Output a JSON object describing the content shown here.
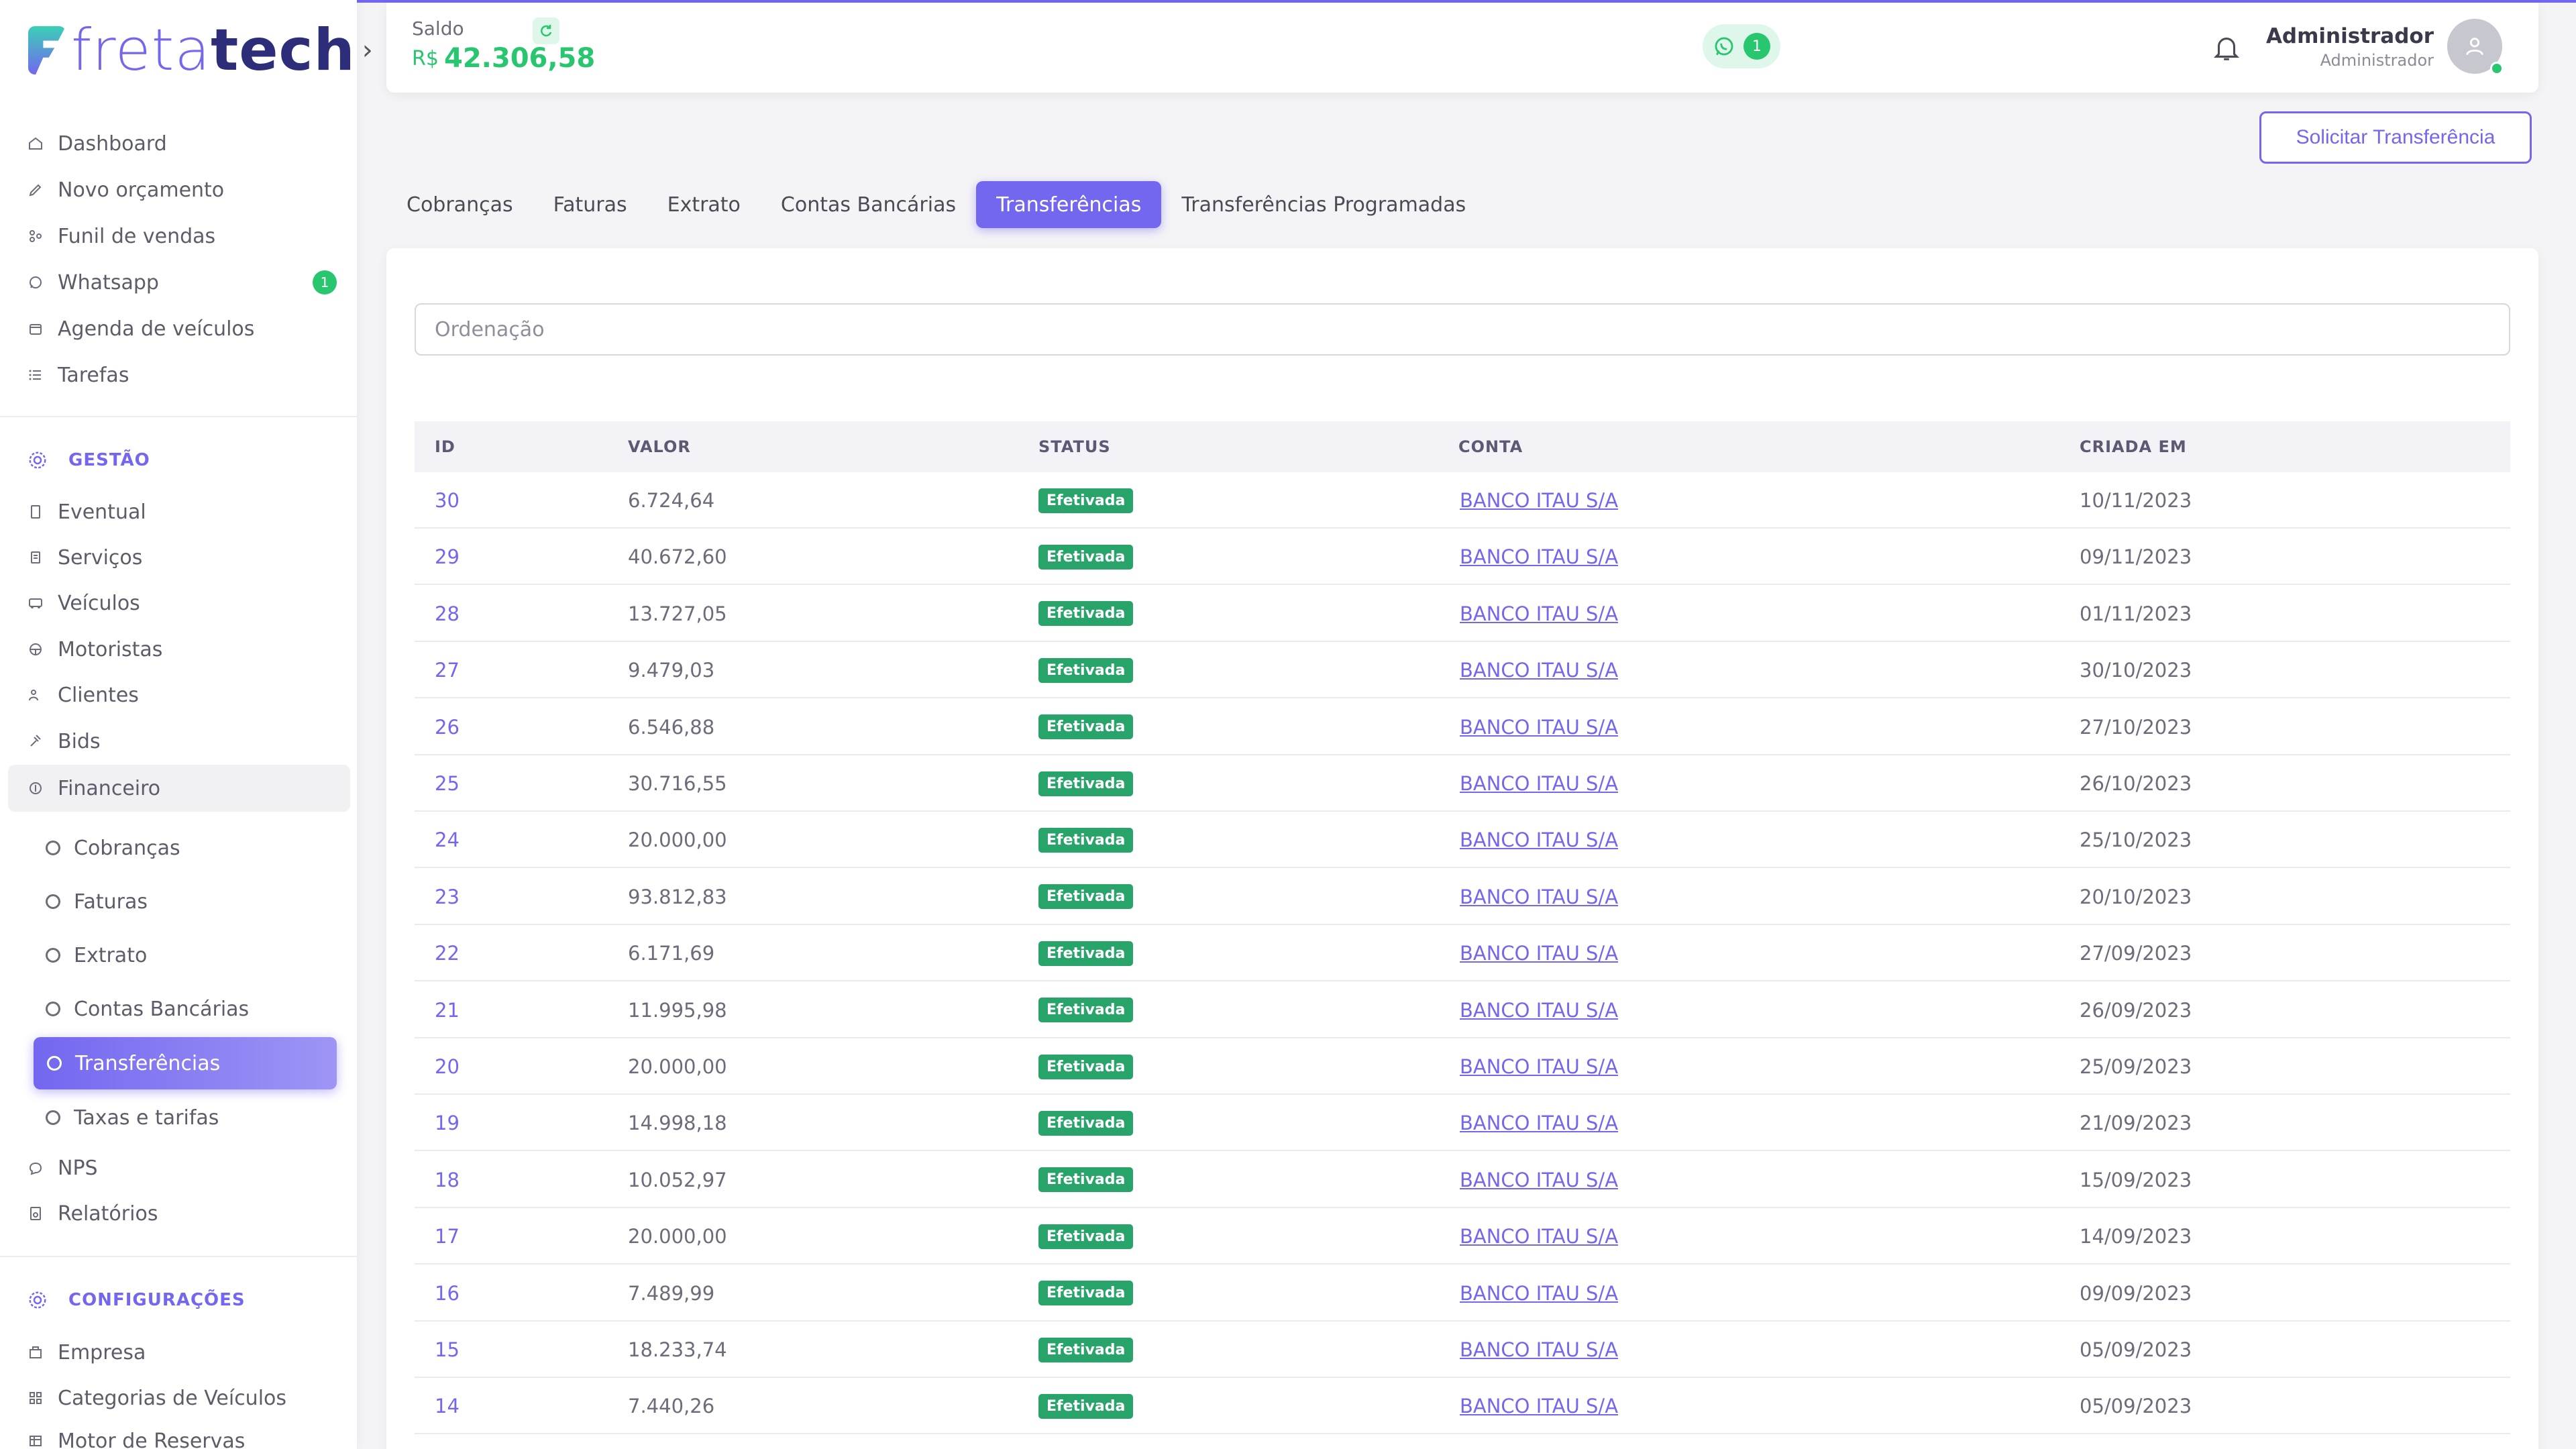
{
  "brand": {
    "name_light": "freta",
    "name_bold": "tech"
  },
  "sidebar": {
    "main_items": [
      {
        "label": "Dashboard"
      },
      {
        "label": "Novo orçamento"
      },
      {
        "label": "Funil de vendas"
      },
      {
        "label": "Whatsapp",
        "badge": "1"
      },
      {
        "label": "Agenda de veículos"
      },
      {
        "label": "Tarefas"
      }
    ],
    "gestao_title": "GESTÃO",
    "gestao_items": [
      {
        "label": "Eventual"
      },
      {
        "label": "Serviços"
      },
      {
        "label": "Veículos"
      },
      {
        "label": "Motoristas"
      },
      {
        "label": "Clientes"
      },
      {
        "label": "Bids"
      },
      {
        "label": "Financeiro"
      }
    ],
    "financeiro_sub": [
      {
        "label": "Cobranças"
      },
      {
        "label": "Faturas"
      },
      {
        "label": "Extrato"
      },
      {
        "label": "Contas Bancárias"
      },
      {
        "label": "Transferências"
      },
      {
        "label": "Taxas e tarifas"
      }
    ],
    "after_items": [
      {
        "label": "NPS"
      },
      {
        "label": "Relatórios"
      }
    ],
    "config_title": "CONFIGURAÇÕES",
    "config_items": [
      {
        "label": "Empresa"
      },
      {
        "label": "Categorias de Veículos"
      },
      {
        "label": "Motor de Reservas"
      }
    ]
  },
  "header": {
    "saldo_label": "Saldo",
    "saldo_currency": "R$",
    "saldo_value": "42.306,58",
    "whatsapp_count": "1",
    "user_name": "Administrador",
    "user_role": "Administrador"
  },
  "actions": {
    "solicitar_label": "Solicitar Transferência"
  },
  "tabs": [
    {
      "label": "Cobranças"
    },
    {
      "label": "Faturas"
    },
    {
      "label": "Extrato"
    },
    {
      "label": "Contas Bancárias"
    },
    {
      "label": "Transferências",
      "active": true
    },
    {
      "label": "Transferências Programadas"
    }
  ],
  "filter": {
    "placeholder": "Ordenação"
  },
  "table": {
    "headers": {
      "id": "ID",
      "valor": "VALOR",
      "status": "STATUS",
      "conta": "CONTA",
      "criada": "CRIADA EM"
    },
    "rows": [
      {
        "id": "30",
        "valor": "6.724,64",
        "status": "Efetivada",
        "conta": "BANCO ITAU S/A",
        "criada": "10/11/2023"
      },
      {
        "id": "29",
        "valor": "40.672,60",
        "status": "Efetivada",
        "conta": "BANCO ITAU S/A",
        "criada": "09/11/2023"
      },
      {
        "id": "28",
        "valor": "13.727,05",
        "status": "Efetivada",
        "conta": "BANCO ITAU S/A",
        "criada": "01/11/2023"
      },
      {
        "id": "27",
        "valor": "9.479,03",
        "status": "Efetivada",
        "conta": "BANCO ITAU S/A",
        "criada": "30/10/2023"
      },
      {
        "id": "26",
        "valor": "6.546,88",
        "status": "Efetivada",
        "conta": "BANCO ITAU S/A",
        "criada": "27/10/2023"
      },
      {
        "id": "25",
        "valor": "30.716,55",
        "status": "Efetivada",
        "conta": "BANCO ITAU S/A",
        "criada": "26/10/2023"
      },
      {
        "id": "24",
        "valor": "20.000,00",
        "status": "Efetivada",
        "conta": "BANCO ITAU S/A",
        "criada": "25/10/2023"
      },
      {
        "id": "23",
        "valor": "93.812,83",
        "status": "Efetivada",
        "conta": "BANCO ITAU S/A",
        "criada": "20/10/2023"
      },
      {
        "id": "22",
        "valor": "6.171,69",
        "status": "Efetivada",
        "conta": "BANCO ITAU S/A",
        "criada": "27/09/2023"
      },
      {
        "id": "21",
        "valor": "11.995,98",
        "status": "Efetivada",
        "conta": "BANCO ITAU S/A",
        "criada": "26/09/2023"
      },
      {
        "id": "20",
        "valor": "20.000,00",
        "status": "Efetivada",
        "conta": "BANCO ITAU S/A",
        "criada": "25/09/2023"
      },
      {
        "id": "19",
        "valor": "14.998,18",
        "status": "Efetivada",
        "conta": "BANCO ITAU S/A",
        "criada": "21/09/2023"
      },
      {
        "id": "18",
        "valor": "10.052,97",
        "status": "Efetivada",
        "conta": "BANCO ITAU S/A",
        "criada": "15/09/2023"
      },
      {
        "id": "17",
        "valor": "20.000,00",
        "status": "Efetivada",
        "conta": "BANCO ITAU S/A",
        "criada": "14/09/2023"
      },
      {
        "id": "16",
        "valor": "7.489,99",
        "status": "Efetivada",
        "conta": "BANCO ITAU S/A",
        "criada": "09/09/2023"
      },
      {
        "id": "15",
        "valor": "18.233,74",
        "status": "Efetivada",
        "conta": "BANCO ITAU S/A",
        "criada": "05/09/2023"
      },
      {
        "id": "14",
        "valor": "7.440,26",
        "status": "Efetivada",
        "conta": "BANCO ITAU S/A",
        "criada": "05/09/2023"
      }
    ]
  },
  "colors": {
    "accent": "#7367f0",
    "success": "#28c76f",
    "status_bg": "#28a36a"
  }
}
